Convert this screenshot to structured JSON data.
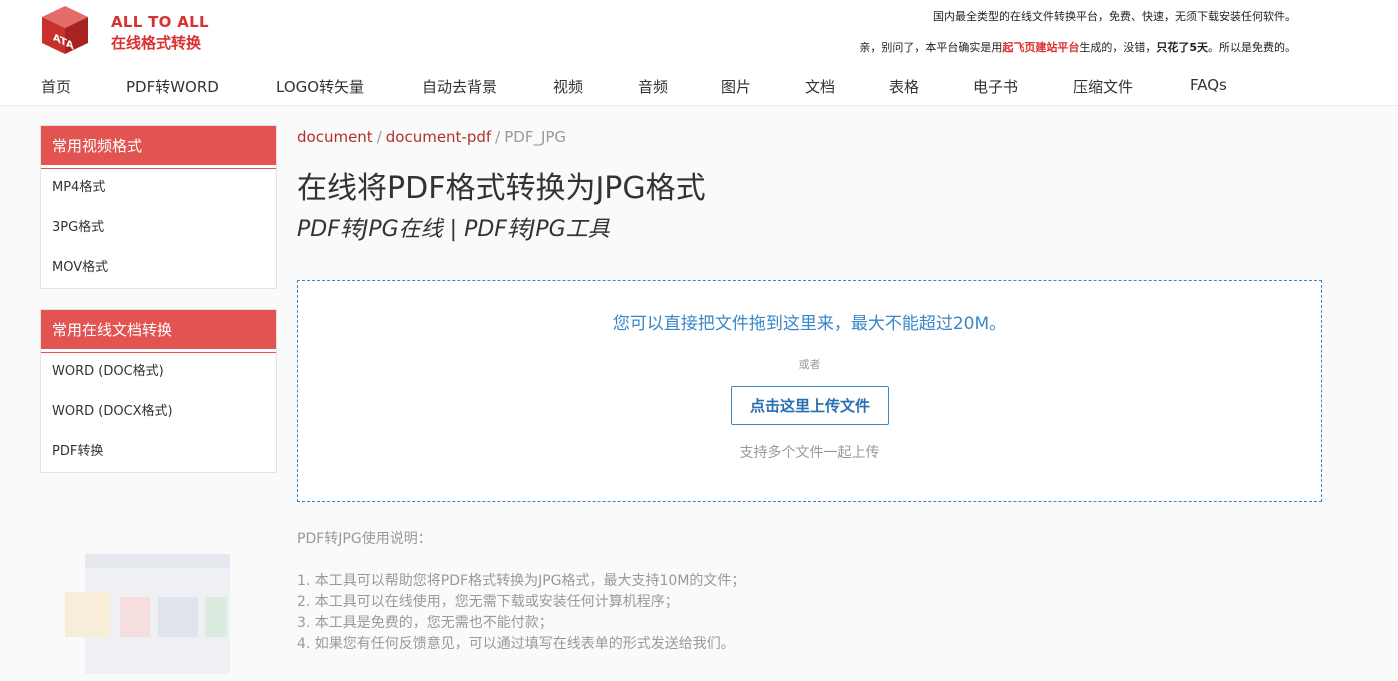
{
  "header": {
    "logo_en": "ALL TO ALL",
    "logo_cn": "在线格式转换",
    "logo_mark": "ATA",
    "slogan_line1": "国内最全类型的在线文件转换平台，免费、快速，无须下载安装任何软件。",
    "slogan_line2_a": "亲，别问了，本平台确实是用",
    "slogan_line2_red": "起飞页建站平台",
    "slogan_line2_b": "生成的，没错，",
    "slogan_line2_bold": "只花了5天",
    "slogan_line2_c": "。所以是免费的。"
  },
  "nav": {
    "items": [
      "首页",
      "PDF转WORD",
      "LOGO转矢量",
      "自动去背景",
      "视频",
      "音频",
      "图片",
      "文档",
      "表格",
      "电子书",
      "压缩文件",
      "FAQs"
    ]
  },
  "sidebar": {
    "panels": [
      {
        "title": "常用视频格式",
        "items": [
          "MP4格式",
          "3PG格式",
          "MOV格式"
        ]
      },
      {
        "title": "常用在线文档转换",
        "items": [
          "WORD (DOC格式)",
          "WORD (DOCX格式)",
          "PDF转换"
        ]
      }
    ]
  },
  "breadcrumb": {
    "items": [
      "document",
      "document-pdf",
      "PDF_JPG"
    ],
    "separator": "/"
  },
  "main": {
    "title": "在线将PDF格式转换为JPG格式",
    "subtitle": "PDF转JPG在线 | PDF转JPG工具"
  },
  "dropzone": {
    "message": "您可以直接把文件拖到这里来，最大不能超过20M。",
    "or": "或者",
    "upload_button": "点击这里上传文件",
    "multi_hint": "支持多个文件一起上传"
  },
  "instructions": {
    "title": "PDF转JPG使用说明：",
    "items": [
      "1. 本工具可以帮助您将PDF格式转换为JPG格式，最大支持10M的文件；",
      "2. 本工具可以在线使用，您无需下载或安装任何计算机程序；",
      "3. 本工具是免费的，您无需也不能付款；",
      "4. 如果您有任何反馈意见，可以通过填写在线表单的形式发送给我们。"
    ]
  },
  "colors": {
    "brand_red": "#d9312f",
    "panel_red": "#e25452",
    "link_blue": "#3a86c8"
  }
}
